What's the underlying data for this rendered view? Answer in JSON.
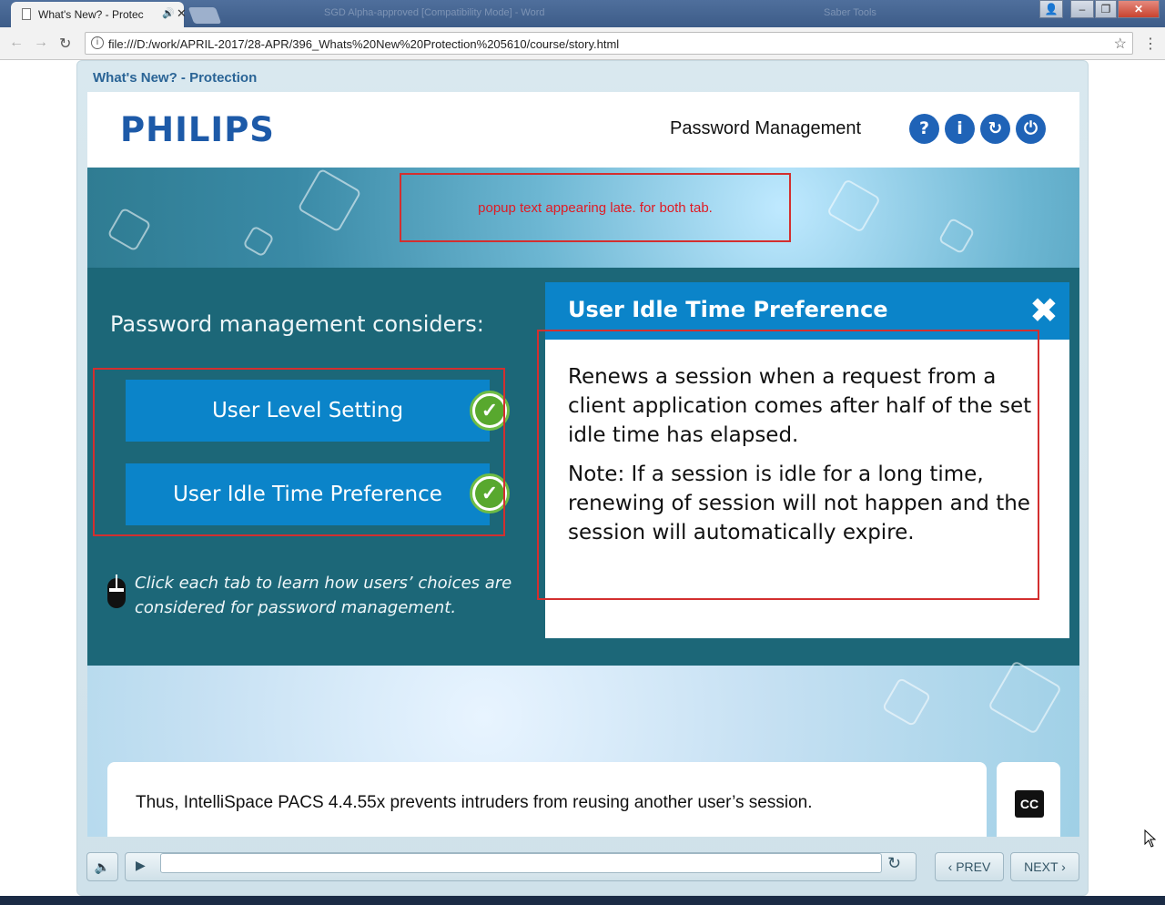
{
  "browser": {
    "tab_title": "What's New? - Protec",
    "tab_speaker_icon": "speaker-icon",
    "url": "file:///D:/work/APRIL-2017/28-APR/396_Whats%20New%20Protection%205610/course/story.html",
    "window_blurred_title": "SGD Alpha-approved [Compatibility Mode] - Word",
    "window_blurred_right": "Saber Tools"
  },
  "course": {
    "title": "What's New? - Protection",
    "logo_text": "PHILIPS",
    "section_title": "Password Management",
    "header_buttons": [
      {
        "name": "help-button",
        "glyph": "?"
      },
      {
        "name": "info-button",
        "glyph": "i"
      },
      {
        "name": "replay-button",
        "glyph": "↻"
      },
      {
        "name": "power-button",
        "glyph": "⏻"
      }
    ]
  },
  "review_note": "popup text appearing late. for both tab.",
  "content": {
    "considers_heading": "Password management considers:",
    "tabs": [
      {
        "label": "User Level Setting",
        "completed": true
      },
      {
        "label": "User Idle Time Preference",
        "completed": true
      }
    ],
    "instruction": "Click each tab to learn how users’ choices are considered for password management."
  },
  "popup": {
    "title": "User Idle Time Preference",
    "paragraphs": [
      "Renews a session when a request from a client application comes after half of the set idle time has elapsed.",
      "Note: If a session is idle for a long time, renewing of session will not happen and the session will automatically expire."
    ]
  },
  "caption": {
    "text": "Thus, IntelliSpace PACS 4.4.55x prevents intruders from reusing another user’s session.",
    "cc_label": "CC"
  },
  "controls": {
    "prev_label": "PREV",
    "next_label": "NEXT",
    "progress": 0
  },
  "colors": {
    "brand_blue": "#1d5aa8",
    "tab_blue": "#0b84c9",
    "panel_teal": "#1c6778",
    "check_green": "#58a82e",
    "review_red": "#d32f2f"
  }
}
